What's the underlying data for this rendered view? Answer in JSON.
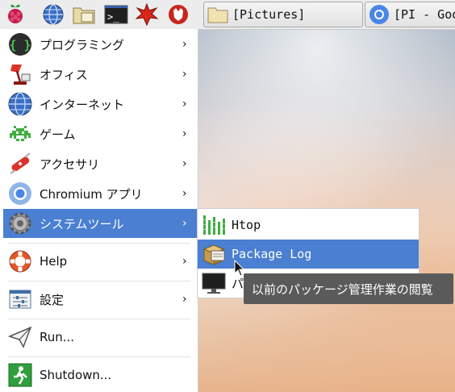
{
  "taskbar": {
    "launchers": [
      "raspberry-menu-icon",
      "web-browser-icon",
      "file-manager-icon",
      "terminal-icon",
      "mathematica-icon",
      "wolfram-icon"
    ],
    "tasks": [
      {
        "label": "[Pictures]",
        "icon": "folder-icon"
      },
      {
        "label": "[PI - Goog",
        "icon": "chromium-icon"
      }
    ]
  },
  "menu": {
    "items": [
      {
        "label": "プログラミング",
        "icon": "programming-icon",
        "submenu": true
      },
      {
        "label": "オフィス",
        "icon": "office-icon",
        "submenu": true
      },
      {
        "label": "インターネット",
        "icon": "internet-icon",
        "submenu": true
      },
      {
        "label": "ゲーム",
        "icon": "games-icon",
        "submenu": true
      },
      {
        "label": "アクセサリ",
        "icon": "accessories-icon",
        "submenu": true
      },
      {
        "label": "Chromium アプリ",
        "icon": "chromium-apps-icon",
        "submenu": true
      },
      {
        "label": "システムツール",
        "icon": "system-tools-icon",
        "submenu": true,
        "active": true
      },
      {
        "label": "Help",
        "icon": "help-icon",
        "submenu": true
      },
      {
        "label": "設定",
        "icon": "preferences-icon",
        "submenu": true
      },
      {
        "label": "Run...",
        "icon": "run-icon",
        "submenu": false
      },
      {
        "label": "Shutdown...",
        "icon": "shutdown-icon",
        "submenu": false
      }
    ],
    "arrow": "›"
  },
  "submenu": {
    "items": [
      {
        "label": "Htop",
        "icon": "htop-icon"
      },
      {
        "label": "Package Log",
        "icon": "package-log-icon",
        "active": true
      },
      {
        "label": "パ",
        "icon": "monitor-icon"
      }
    ]
  },
  "tooltip": {
    "text": "以前のパッケージ管理作業の閲覧"
  },
  "colors": {
    "accent": "#4a7fd1",
    "tooltip_bg": "#5a5a5a"
  }
}
